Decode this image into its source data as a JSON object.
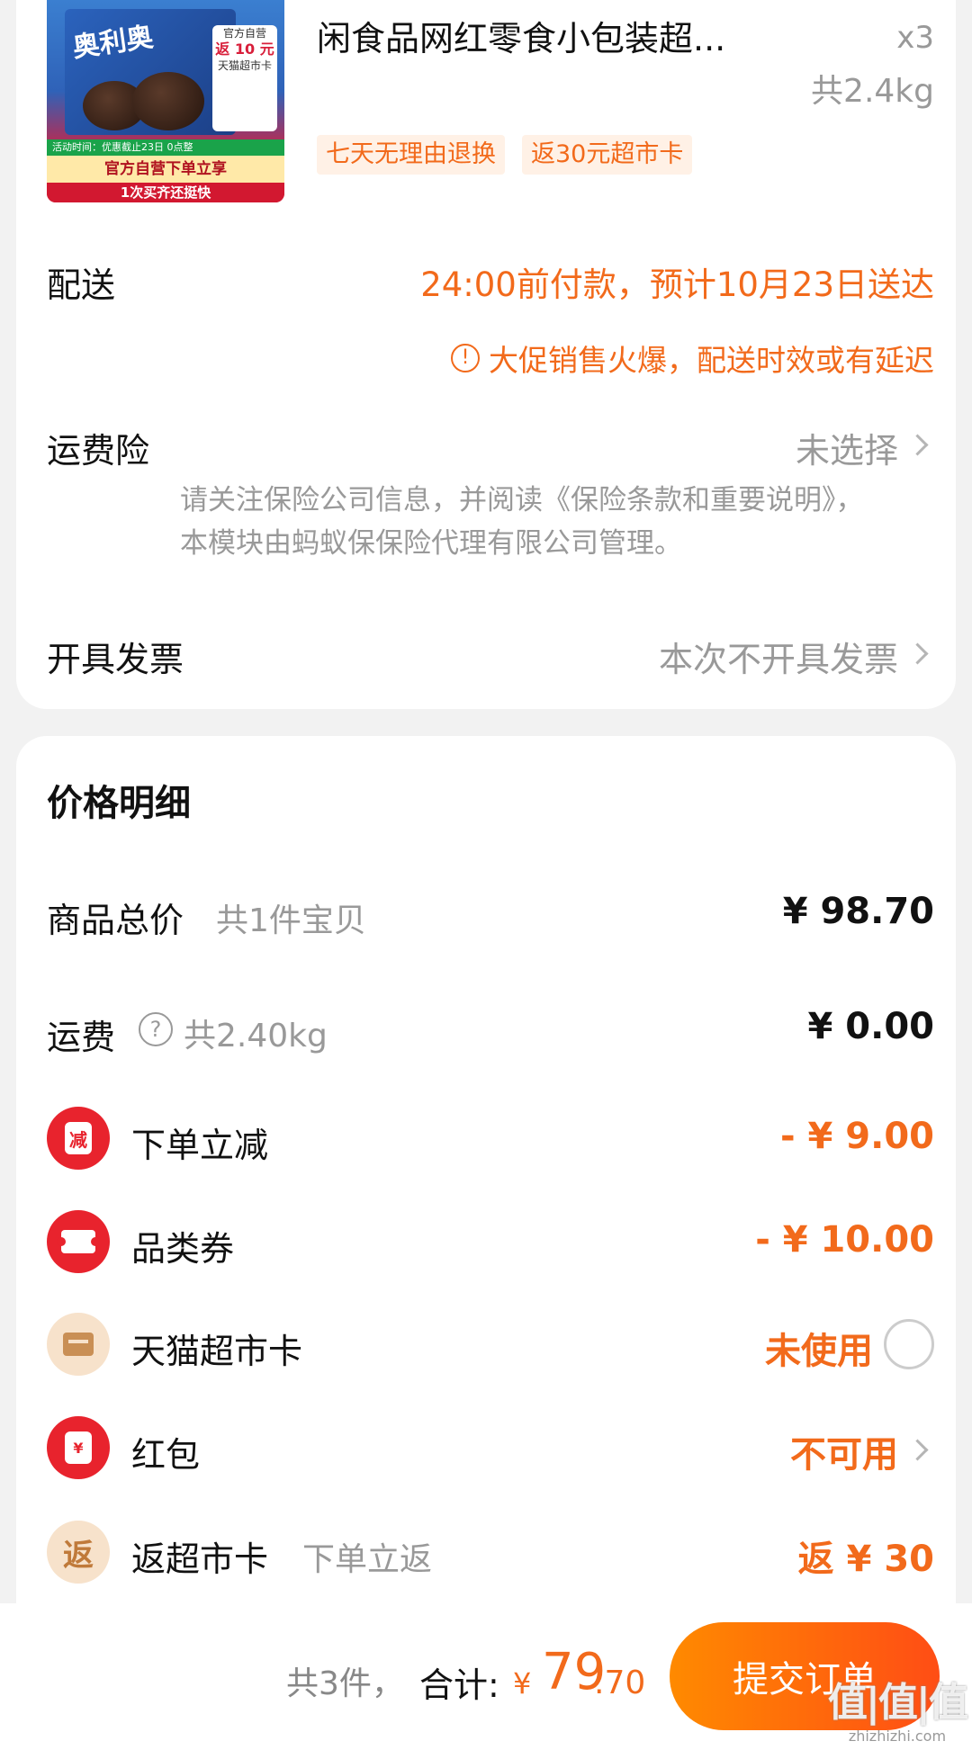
{
  "product": {
    "image_brand": "奥利奥",
    "image_promo_top": "官方自营",
    "image_promo_amount": "返 10 元",
    "image_promo_sub": "天猫超市卡",
    "image_strip_activity": "活动时间：优惠截止23日 0点整",
    "image_strip_main": "官方自营下单立享",
    "image_strip_bottom": "1次买齐还挺快",
    "title": "闲食品网红零食小包装超...",
    "quantity": "x3",
    "weight": "共2.4kg",
    "tags": [
      "七天无理由退换",
      "返30元超市卡"
    ]
  },
  "delivery": {
    "label": "配送",
    "value": "24:00前付款，预计10月23日送达",
    "note_icon": "!",
    "note": "大促销售火爆，配送时效或有延迟"
  },
  "insurance": {
    "label": "运费险",
    "value": "未选择",
    "note": "请关注保险公司信息，并阅读《保险条款和重要说明》，本模块由蚂蚁保保险代理有限公司管理。"
  },
  "invoice": {
    "label": "开具发票",
    "value": "本次不开具发票"
  },
  "price_detail": {
    "title": "价格明细",
    "goods": {
      "label": "商品总价",
      "sub": "共1件宝贝",
      "value": "¥ 98.70"
    },
    "shipping": {
      "label": "运费",
      "help": "?",
      "sub": "共2.40kg",
      "value": "¥ 0.00"
    },
    "discount": {
      "icon_char": "减",
      "label": "下单立减",
      "value": "- ¥ 9.00"
    },
    "coupon": {
      "label": "品类券",
      "value": "- ¥ 10.00"
    },
    "market_card": {
      "label": "天猫超市卡",
      "value": "未使用"
    },
    "red_packet": {
      "icon_char": "¥",
      "label": "红包",
      "value": "不可用"
    },
    "refund_card": {
      "icon_char": "返",
      "label": "返超市卡",
      "sub": "下单立返",
      "value": "返 ¥ 30"
    }
  },
  "footer": {
    "count": "共3件，",
    "total_label": "合计:",
    "currency": "¥",
    "total_int": "79",
    "total_dec": ".70",
    "submit": "提交订单"
  },
  "watermark": {
    "logo": "值|值|值",
    "url": "zhizhizhi.com"
  },
  "colors": {
    "accent": "#f26a1b",
    "red": "#e8232d",
    "muted": "#999999"
  }
}
